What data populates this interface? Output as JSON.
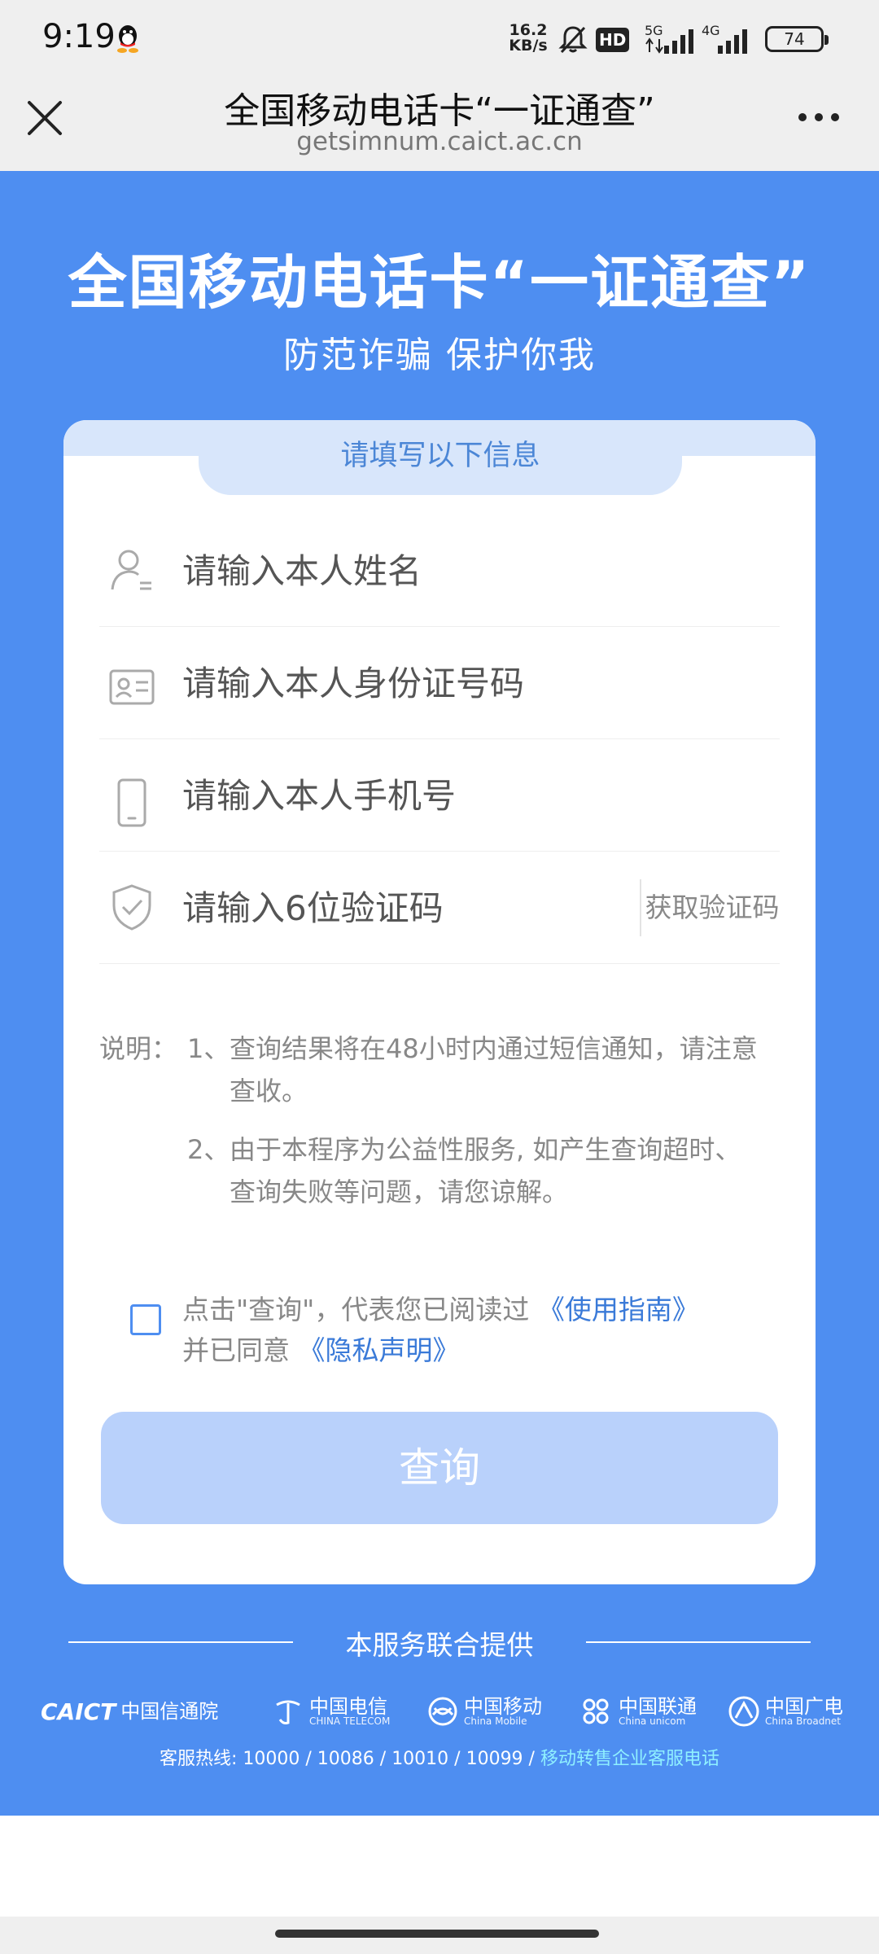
{
  "status_bar": {
    "time": "9:19",
    "net_speed_value": "16.2",
    "net_speed_unit": "KB/s",
    "hd": "HD",
    "signal_5g": "5G",
    "signal_4g": "4G",
    "battery": "74"
  },
  "title_bar": {
    "title": "全国移动电话卡“一证通查”",
    "url": "getsimnum.caict.ac.cn"
  },
  "hero": {
    "title": "全国移动电话卡“一证通查”",
    "subtitle": "防范诈骗 保护你我"
  },
  "form": {
    "header": "请填写以下信息",
    "name_placeholder": "请输入本人姓名",
    "id_placeholder": "请输入本人身份证号码",
    "phone_placeholder": "请输入本人手机号",
    "code_placeholder": "请输入6位验证码",
    "get_code_label": "获取验证码"
  },
  "notes": {
    "label": "说明：",
    "items": [
      {
        "num": "1、",
        "text": "查询结果将在48小时内通过短信通知，请注意查收。"
      },
      {
        "num": "2、",
        "text": "由于本程序为公益性服务, 如产生查询超时、查询失败等问题，请您谅解。"
      }
    ]
  },
  "agreement": {
    "prefix": "点击\"查询\"，代表您已阅读过",
    "guide_link": "《使用指南》",
    "middle": "并已同意",
    "privacy_link": "《隐私声明》"
  },
  "query_button": "查询",
  "footer": {
    "provided_by": "本服务联合提供",
    "logos": [
      {
        "mark": "CAICT",
        "name": "中国信通院",
        "sub": ""
      },
      {
        "mark": "",
        "name": "中国电信",
        "sub": "CHINA TELECOM"
      },
      {
        "mark": "",
        "name": "中国移动",
        "sub": "China Mobile"
      },
      {
        "mark": "",
        "name": "中国联通",
        "sub": "China unicom"
      },
      {
        "mark": "",
        "name": "中国广电",
        "sub": "China Broadnet"
      }
    ],
    "hotline_text": "客服热线: 10000 / 10086 / 10010 / 10099 / ",
    "hotline_link": "移动转售企业客服电话"
  },
  "colors": {
    "primary_blue": "#4e8ef1",
    "tab_bg": "#d8e6fb",
    "button_disabled": "#b9d1fb",
    "link": "#3a7ad8"
  }
}
